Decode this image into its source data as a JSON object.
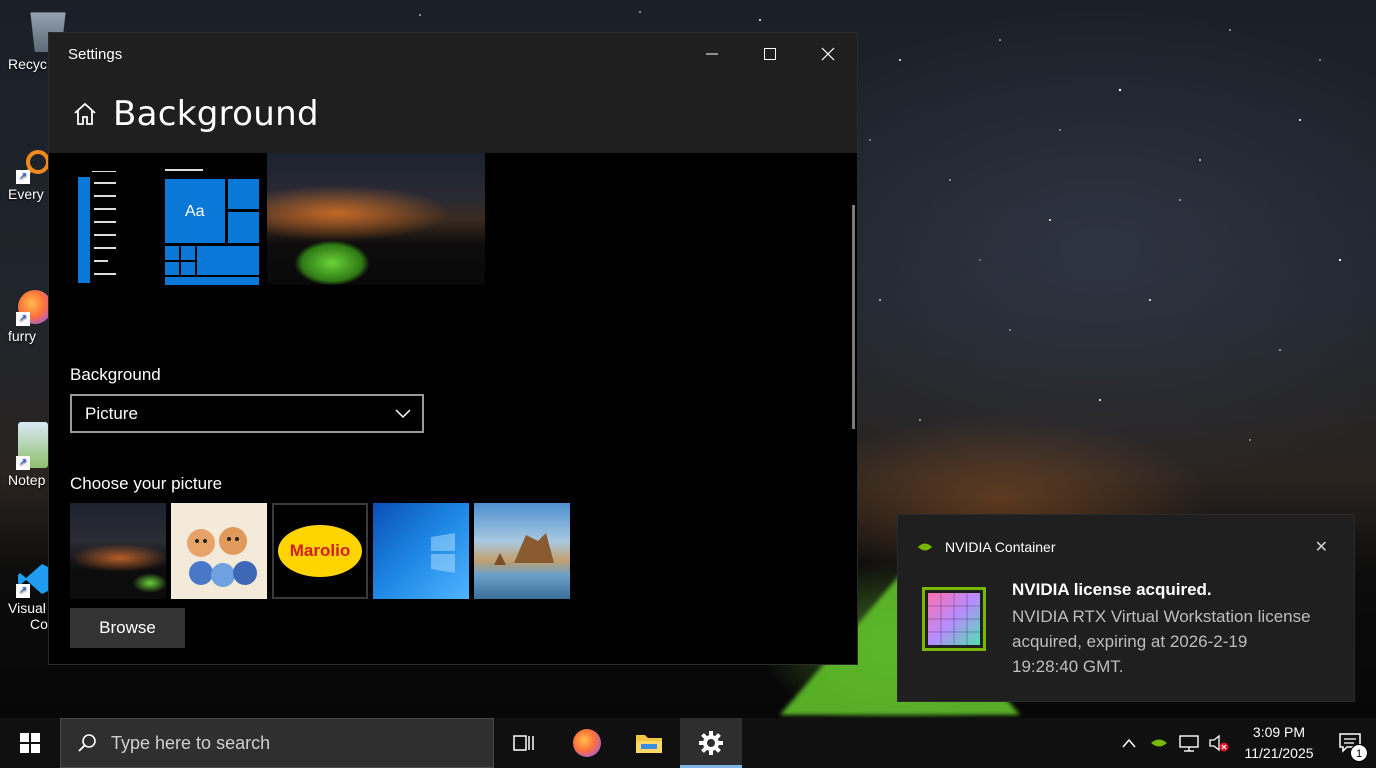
{
  "desktop": {
    "icons": [
      {
        "label": "Recyc",
        "icon": "recycle-bin-icon"
      },
      {
        "label": "Every",
        "icon": "everything-search-icon"
      },
      {
        "label": "furry",
        "icon": "firefox-icon"
      },
      {
        "label": "Notep",
        "icon": "notepad-icon"
      },
      {
        "label": "Visual",
        "label2": "Co",
        "icon": "vscode-icon"
      }
    ]
  },
  "window": {
    "title": "Settings",
    "controls": {
      "minimize": "–",
      "maximize": "☐",
      "close": "✕"
    },
    "page_title": "Background",
    "background_label": "Background",
    "background_value": "Picture",
    "choose_picture_label": "Choose your picture",
    "preview_tile_text": "Aa",
    "thumbnails": [
      {
        "name": "night-sky-tent"
      },
      {
        "name": "cartoon-dogs"
      },
      {
        "name": "marolio",
        "text": "Marolio"
      },
      {
        "name": "windows-blue"
      },
      {
        "name": "beach-rocks"
      }
    ],
    "browse_label": "Browse"
  },
  "notification": {
    "app_name": "NVIDIA Container",
    "title": "NVIDIA license acquired.",
    "body": "NVIDIA RTX Virtual Workstation license acquired, expiring at 2026-2-19 19:28:40 GMT.",
    "close": "✕",
    "accent": "#76b900"
  },
  "taskbar": {
    "search_placeholder": "Type here to search",
    "time": "3:09 PM",
    "date": "11/21/2025",
    "notification_count": "1",
    "apps": [
      "task-view-icon",
      "firefox-icon",
      "file-explorer-icon",
      "settings-icon"
    ]
  }
}
